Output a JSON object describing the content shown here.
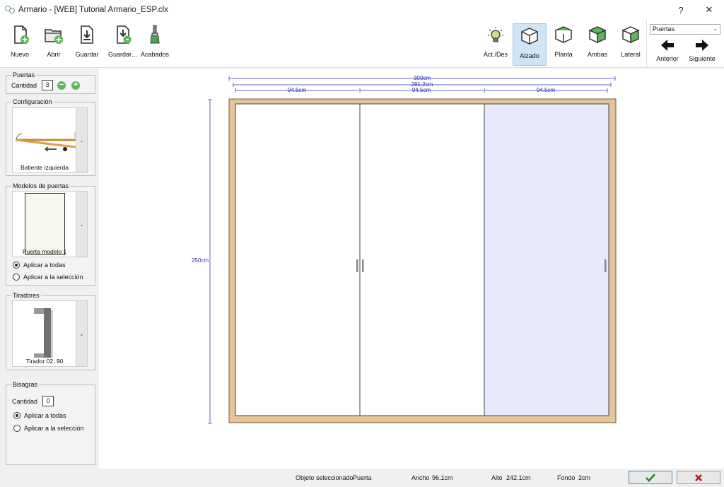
{
  "window": {
    "title": "Armario - [WEB] Tutorial Armario_ESP.clx",
    "help": "?",
    "close": "✕"
  },
  "toolbar": {
    "left": [
      {
        "label": "Nuevo",
        "icon": "new-file-icon"
      },
      {
        "label": "Abrir",
        "icon": "open-folder-icon"
      },
      {
        "label": "Guardar",
        "icon": "save-icon"
      },
      {
        "label": "Guardar…",
        "icon": "save-as-icon"
      },
      {
        "label": "Acabados",
        "icon": "brush-icon"
      }
    ],
    "right": [
      {
        "label": "Act./Des",
        "icon": "lightbulb-icon"
      },
      {
        "label": "Alzado",
        "icon": "cube-front-icon",
        "active": true
      },
      {
        "label": "Planta",
        "icon": "cube-top-icon"
      },
      {
        "label": "Ambas",
        "icon": "cube-both-icon"
      },
      {
        "label": "Lateral",
        "icon": "cube-side-icon"
      }
    ],
    "combo_value": "Puertas",
    "prev_label": "Anterior",
    "next_label": "Siguiente"
  },
  "panel": {
    "puertas": {
      "title": "Puertas",
      "qty_label": "Cantidad",
      "qty_value": "3"
    },
    "config": {
      "title": "Configuración",
      "caption": "Batiente izquierda"
    },
    "modelos": {
      "title": "Modelos de puertas",
      "caption": "Puerta modelo 1",
      "apply_all": "Aplicar a todas",
      "apply_sel": "Aplicar a la selección"
    },
    "tiradores": {
      "title": "Tiradores",
      "caption": "Tirador 02, 90"
    },
    "bisagras": {
      "title": "Bisagras",
      "qty_label": "Cantidad",
      "qty_value": "0",
      "apply_all": "Aplicar a todas",
      "apply_sel": "Aplicar a la selección"
    }
  },
  "drawing": {
    "total_width": "300cm",
    "inner_width": "291.2cm",
    "door_widths": [
      "94.5cm",
      "94.5cm",
      "94.5cm"
    ],
    "height": "250cm",
    "colors": {
      "frame": "#e6c49a",
      "selected": "#e8e8fb",
      "dimension": "#2a2ab8"
    }
  },
  "status": {
    "obj_label": "Objeto seleccionado",
    "obj_value": "Puerta",
    "ancho_label": "Ancho",
    "ancho_value": "96.1cm",
    "alto_label": "Alto",
    "alto_value": "242.1cm",
    "fondo_label": "Fondo",
    "fondo_value": "2cm"
  }
}
